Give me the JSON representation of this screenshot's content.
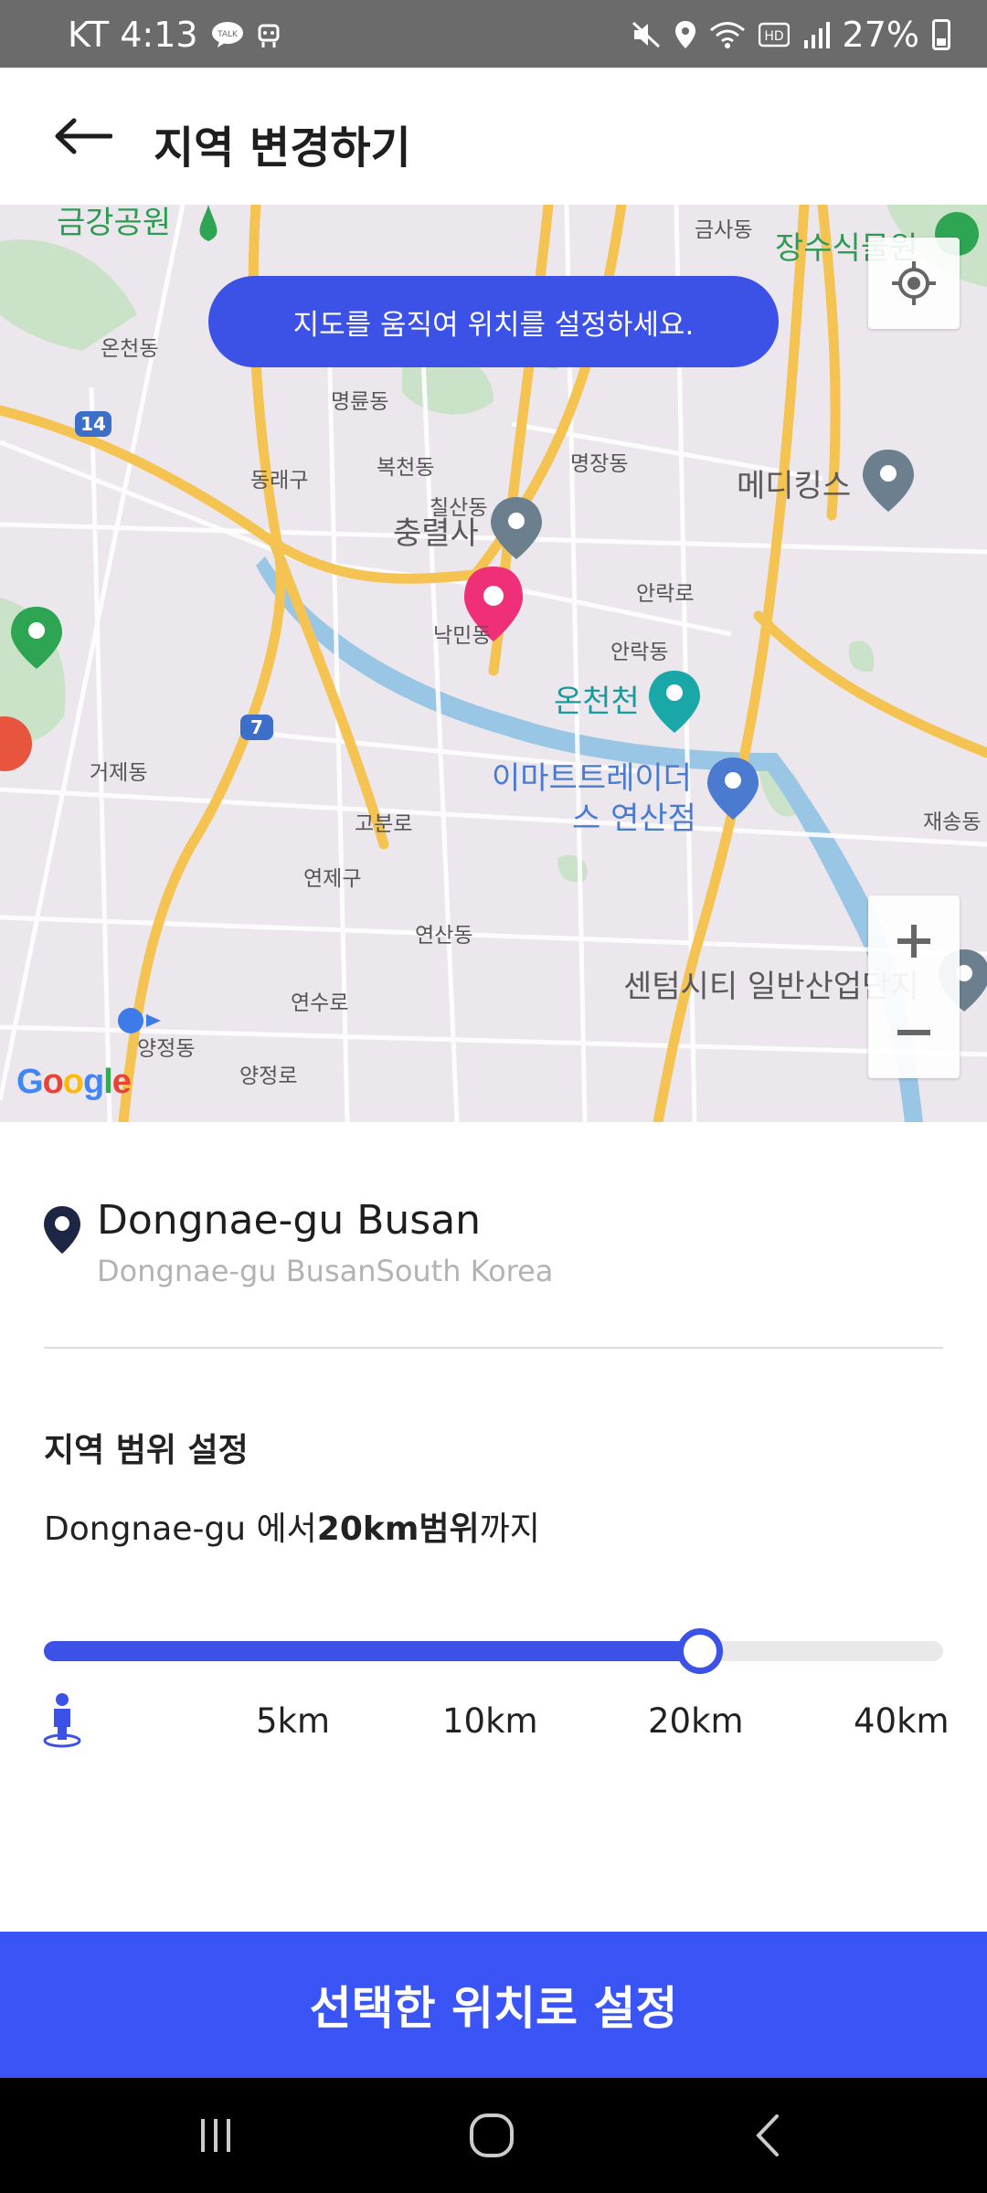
{
  "status_bar": {
    "carrier_time": "KT 4:13",
    "battery": "27%",
    "icons": [
      "kakaotalk-icon",
      "robot-icon",
      "mute-icon",
      "location-icon",
      "wifi-icon",
      "hd-icon",
      "signal-icon",
      "battery-icon"
    ]
  },
  "header": {
    "title": "지역 변경하기",
    "back_icon": "arrow-left-icon"
  },
  "map": {
    "hint": "지도를 움직여 위치를 설정하세요.",
    "labels": {
      "geumgang": "금강공원",
      "geumsa": "금사동",
      "jangsu": "장수식물원",
      "oncheon": "온천동",
      "myeongnyun": "명륜동",
      "dongnae": "동래구",
      "bokcheon": "복천동",
      "myeongjang": "명장동",
      "medicuss": "메디킹스",
      "chilsan": "칠산동",
      "chungryeolsa": "충렬사",
      "nakmin": "낙민동",
      "allak_ro": "안락로",
      "allak": "안락동",
      "oncheoncheon": "온천천",
      "emart_1": "이마트트레이더",
      "emart_2": "스 연산점",
      "geoje": "거제동",
      "gobun": "고분로",
      "yeonje": "연제구",
      "yeonsan": "연산동",
      "centum": "센텀시티 일반산업단지",
      "jaesong": "재송동",
      "yangjeong": "양정동",
      "yangjeong_ro": "양정로",
      "yeonsu": "연수로",
      "route14": "14",
      "route7": "7"
    },
    "google": "Google",
    "zoom_in": "+",
    "zoom_out": "−"
  },
  "location": {
    "title": "Dongnae-gu Busan",
    "subtitle": "Dongnae-gu BusanSouth Korea"
  },
  "range": {
    "heading": "지역 범위 설정",
    "desc_prefix": "Dongnae-gu 에서",
    "desc_bold": "20km범위",
    "desc_suffix": "까지",
    "ticks": [
      "5km",
      "10km",
      "20km",
      "40km"
    ],
    "selected_fraction": 0.73
  },
  "confirm_button": "선택한 위치로 설정",
  "colors": {
    "accent": "#3c52e6",
    "pin": "#ef2f77",
    "road": "#f5c351"
  }
}
